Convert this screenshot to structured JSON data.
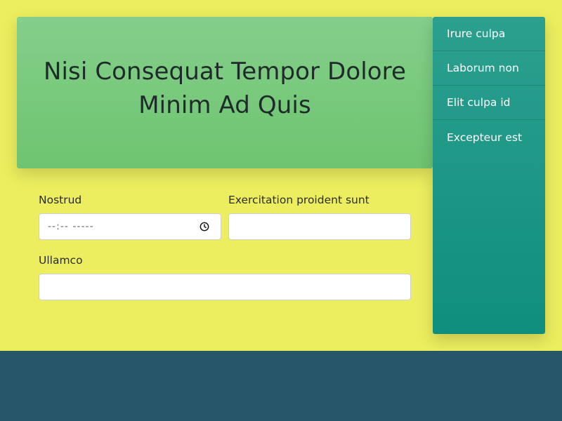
{
  "hero": {
    "title": "Nisi Consequat Tempor Dolore Minim Ad Quis"
  },
  "sidebar": {
    "items": [
      {
        "label": "Irure culpa"
      },
      {
        "label": "Laborum non"
      },
      {
        "label": "Elit culpa id"
      },
      {
        "label": "Excepteur est"
      }
    ]
  },
  "form": {
    "fields": [
      {
        "label": "Nostrud",
        "placeholder": "--:-- -----",
        "icon": "clock-icon"
      },
      {
        "label": "Exercitation proident sunt",
        "value": ""
      },
      {
        "label": "Ullamco",
        "value": ""
      }
    ]
  },
  "colors": {
    "background": "#ecee5f",
    "hero": "#7aca7e",
    "sidebar": "#1a9584",
    "footer": "#285669"
  }
}
